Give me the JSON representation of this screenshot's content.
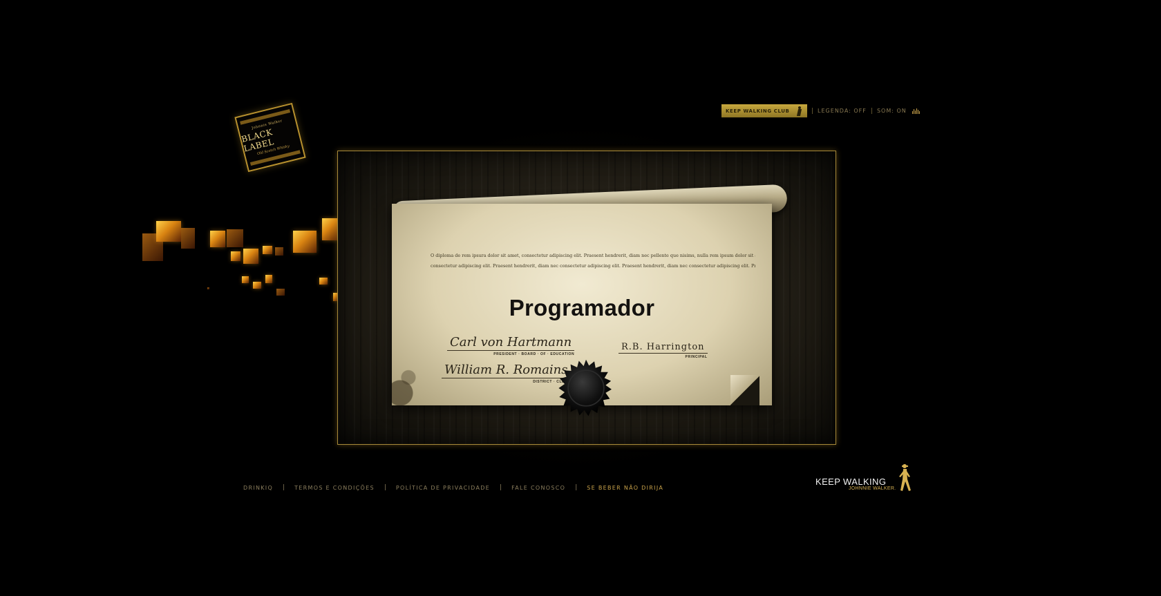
{
  "brand": {
    "label_line1": "Johnnie Walker",
    "label_line2": "BLACK LABEL",
    "label_line3": "Old Scotch Whisky"
  },
  "topbar": {
    "club_button": "KEEP WALKING CLUB",
    "legend": "LEGENDA: OFF",
    "sound": "SOM: ON",
    "separator": "|"
  },
  "diploma": {
    "body_line1": "O diploma de rem ipsura dolor sit amet, consectetur adipiscing elit. Praesent hendrerit, diam nec pellente que nisims, nulla rem ipsum dolor sit amet,",
    "body_line2": "consectetur adipiscing elit. Praesent hendrerit, diam nec consectetur adipiscing elit. Praesent hendrerit, diam nec consectetur adipiscing elit. Praesen",
    "title": "Programador",
    "signature1_name": "Carl von Hartmann",
    "signature1_role": "PRESIDENT · BOARD · OF · EDUCATION",
    "signature2_name": "R.B. Harrington",
    "signature2_role": "PRINCIPAL",
    "signature3_name": "William R. Romains",
    "signature3_role": "DISTRICT · CLERK"
  },
  "footer": {
    "links": [
      "DRINKIQ",
      "TERMOS E CONDIÇÕES",
      "POLÍTICA DE PRIVACIDADE",
      "FALE CONOSCO",
      "SE BEBER NÃO DIRIJA"
    ],
    "separator": "|"
  },
  "logo": {
    "headline": "KEEP WALKING",
    "subline": "JOHNNIE WALKER."
  },
  "colors": {
    "background": "#000000",
    "gold": "#c9a24a",
    "frame": "#a88a3a",
    "parchment": "#efe7cc"
  },
  "icons": {
    "club": "striding-man-icon",
    "sound": "sound-bars-icon",
    "seal": "wax-seal-icon",
    "logo": "striding-man-icon"
  }
}
